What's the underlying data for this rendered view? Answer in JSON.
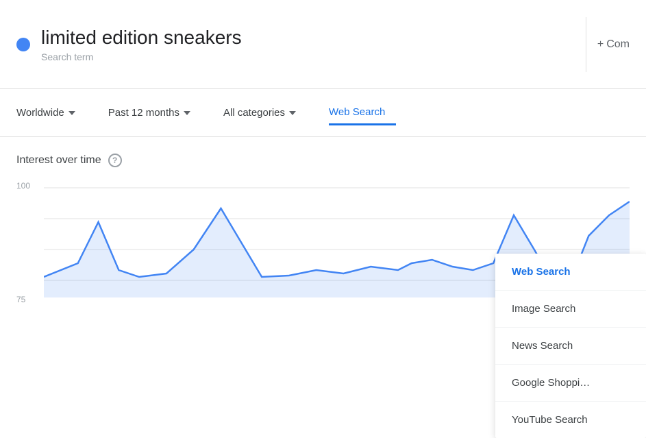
{
  "header": {
    "title": "limited edition sneakers",
    "subtitle": "Search term",
    "dot_color": "#4285f4",
    "compare_icon": "+",
    "compare_label": "Com"
  },
  "filters": {
    "location": {
      "label": "Worldwide",
      "has_dropdown": true
    },
    "time_range": {
      "label": "Past 12 months",
      "has_dropdown": true
    },
    "category": {
      "label": "All categories",
      "has_dropdown": true
    },
    "search_type": {
      "label": "Web Search",
      "has_dropdown": false,
      "active": true
    }
  },
  "section": {
    "title": "Interest over time",
    "help_tooltip": "?"
  },
  "chart": {
    "y_labels": [
      "100",
      "75"
    ],
    "accent_color": "#4285f4"
  },
  "dropdown_menu": {
    "items": [
      {
        "id": "web-search",
        "label": "Web Search",
        "active": true
      },
      {
        "id": "image-search",
        "label": "Image Search",
        "active": false
      },
      {
        "id": "news-search",
        "label": "News Search",
        "active": false
      },
      {
        "id": "google-shopping",
        "label": "Google Shoppi…",
        "active": false
      },
      {
        "id": "youtube-search",
        "label": "YouTube Search",
        "active": false
      }
    ]
  }
}
